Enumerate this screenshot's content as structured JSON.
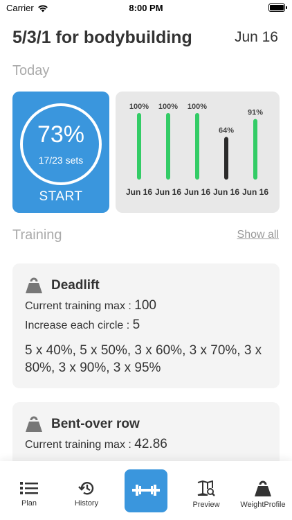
{
  "status_bar": {
    "carrier": "Carrier",
    "time": "8:00 PM"
  },
  "header": {
    "title": "5/3/1 for bodybuilding",
    "date": "Jun 16"
  },
  "today": {
    "label": "Today",
    "progress": {
      "percent_text": "73%",
      "percent": 73,
      "sets_text": "17/23 sets",
      "start_label": "START"
    }
  },
  "history_chart": {
    "type": "bar",
    "bars": [
      {
        "date": "Jun 16",
        "percent": 100,
        "label": "100%",
        "color": "#33cc66"
      },
      {
        "date": "Jun 16",
        "percent": 100,
        "label": "100%",
        "color": "#33cc66"
      },
      {
        "date": "Jun 16",
        "percent": 100,
        "label": "100%",
        "color": "#33cc66"
      },
      {
        "date": "Jun 16",
        "percent": 64,
        "label": "64%",
        "color": "#2b2a2a"
      },
      {
        "date": "Jun 16",
        "percent": 91,
        "label": "91%",
        "color": "#33cc66"
      }
    ]
  },
  "training": {
    "label": "Training",
    "show_all": "Show all",
    "exercises": [
      {
        "name": "Deadlift",
        "max_label": "Current training max : ",
        "max_value": "100",
        "increase_label": "Increase each circle : ",
        "increase_value": "5",
        "scheme": "5 x 40%, 5 x 50%, 3 x 60%, 3 x 70%, 3 x 80%, 3 x 90%, 3 x 95%"
      },
      {
        "name": "Bent-over row",
        "max_label": "Current training max : ",
        "max_value": "42.86"
      }
    ]
  },
  "tabbar": {
    "plan": "Plan",
    "history": "History",
    "preview": "Preview",
    "weight_profile": "WeightProfile"
  },
  "colors": {
    "accent": "#3a96dd",
    "success": "#33cc66",
    "card_bg": "#f4f4f4",
    "muted_text": "#aaaaaa"
  }
}
